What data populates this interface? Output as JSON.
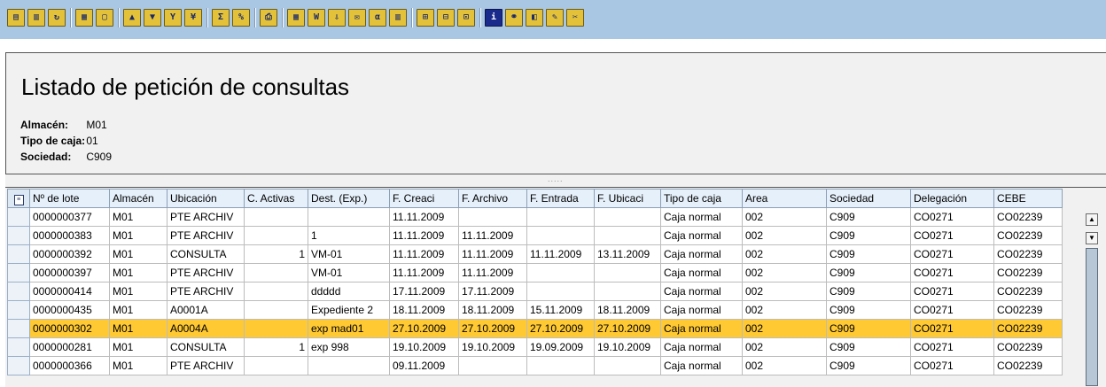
{
  "toolbar": {
    "buttons": [
      {
        "icon": "details-icon",
        "glyph": "▤"
      },
      {
        "icon": "select-layout-icon",
        "glyph": "▥"
      },
      {
        "icon": "refresh-icon",
        "glyph": "↻"
      },
      {
        "icon": "select-all-icon",
        "glyph": "▦"
      },
      {
        "icon": "deselect-all-icon",
        "glyph": "▢"
      },
      {
        "icon": "sort-ascending-icon",
        "glyph": "▲"
      },
      {
        "icon": "sort-descending-icon",
        "glyph": "▼"
      },
      {
        "icon": "filter-icon",
        "glyph": "Y"
      },
      {
        "icon": "delete-filter-icon",
        "glyph": "¥"
      },
      {
        "icon": "sum-icon",
        "glyph": "Σ"
      },
      {
        "icon": "subtotal-icon",
        "glyph": "%"
      },
      {
        "icon": "print-preview-icon",
        "glyph": "⎙"
      },
      {
        "icon": "export-spreadsheet-icon",
        "glyph": "▦"
      },
      {
        "icon": "word-processing-icon",
        "glyph": "W"
      },
      {
        "icon": "local-file-icon",
        "glyph": "⇩"
      },
      {
        "icon": "send-mail-icon",
        "glyph": "✉"
      },
      {
        "icon": "abc-analysis-icon",
        "glyph": "α"
      },
      {
        "icon": "graphic-icon",
        "glyph": "▥"
      },
      {
        "icon": "change-layout-icon",
        "glyph": "⊞"
      },
      {
        "icon": "select-layout-2-icon",
        "glyph": "⊟"
      },
      {
        "icon": "save-layout-icon",
        "glyph": "⊡"
      },
      {
        "icon": "information-icon",
        "glyph": "i"
      },
      {
        "icon": "link-icon",
        "glyph": "⚭"
      },
      {
        "icon": "documents-icon",
        "glyph": "◧"
      },
      {
        "icon": "edit-icon",
        "glyph": "✎"
      },
      {
        "icon": "tools-icon",
        "glyph": "✂"
      }
    ]
  },
  "header": {
    "title": "Listado de petición de consultas",
    "fields": [
      {
        "label": "Almacén:",
        "value": "M01"
      },
      {
        "label": "Tipo de caja:",
        "value": "01"
      },
      {
        "label": "Sociedad:",
        "value": "C909"
      }
    ]
  },
  "splitter": {
    "grip": "....."
  },
  "grid": {
    "columns": [
      "Nº de lote",
      "Almacén",
      "Ubicación",
      "C. Activas",
      "Dest. (Exp.)",
      "F. Creaci",
      "F. Archivo",
      "F. Entrada",
      "F. Ubicaci",
      "Tipo de caja",
      "Area",
      "Sociedad",
      "Delegación",
      "CEBE"
    ],
    "rows": [
      [
        "0000000377",
        "M01",
        "PTE ARCHIV",
        "",
        "",
        "11.11.2009",
        "",
        "",
        "",
        "Caja normal",
        "002",
        "C909",
        "CO0271",
        "CO02239"
      ],
      [
        "0000000383",
        "M01",
        "PTE ARCHIV",
        "",
        "1",
        "11.11.2009",
        "11.11.2009",
        "",
        "",
        "Caja normal",
        "002",
        "C909",
        "CO0271",
        "CO02239"
      ],
      [
        "0000000392",
        "M01",
        "CONSULTA",
        "1",
        "VM-01",
        "11.11.2009",
        "11.11.2009",
        "11.11.2009",
        "13.11.2009",
        "Caja normal",
        "002",
        "C909",
        "CO0271",
        "CO02239"
      ],
      [
        "0000000397",
        "M01",
        "PTE ARCHIV",
        "",
        "VM-01",
        "11.11.2009",
        "11.11.2009",
        "",
        "",
        "Caja normal",
        "002",
        "C909",
        "CO0271",
        "CO02239"
      ],
      [
        "0000000414",
        "M01",
        "PTE ARCHIV",
        "",
        "ddddd",
        "17.11.2009",
        "17.11.2009",
        "",
        "",
        "Caja normal",
        "002",
        "C909",
        "CO0271",
        "CO02239"
      ],
      [
        "0000000435",
        "M01",
        "A0001A",
        "",
        "Expediente 2",
        "18.11.2009",
        "18.11.2009",
        "15.11.2009",
        "18.11.2009",
        "Caja normal",
        "002",
        "C909",
        "CO0271",
        "CO02239"
      ],
      [
        "0000000302",
        "M01",
        "A0004A",
        "",
        "exp mad01",
        "27.10.2009",
        "27.10.2009",
        "27.10.2009",
        "27.10.2009",
        "Caja normal",
        "002",
        "C909",
        "CO0271",
        "CO02239"
      ],
      [
        "0000000281",
        "M01",
        "CONSULTA",
        "1",
        "exp 998",
        "19.10.2009",
        "19.10.2009",
        "19.09.2009",
        "19.10.2009",
        "Caja normal",
        "002",
        "C909",
        "CO0271",
        "CO02239"
      ],
      [
        "0000000366",
        "M01",
        "PTE ARCHIV",
        "",
        "",
        "09.11.2009",
        "",
        "",
        "",
        "Caja normal",
        "002",
        "C909",
        "CO0271",
        "CO02239"
      ]
    ],
    "highlighted_row": 6
  },
  "scrollbar": {
    "up": "▲",
    "down": "▼"
  },
  "colors": {
    "highlight": "#ffc933",
    "toolbar": "#a9c7e3",
    "panel": "#f1f1f1"
  }
}
